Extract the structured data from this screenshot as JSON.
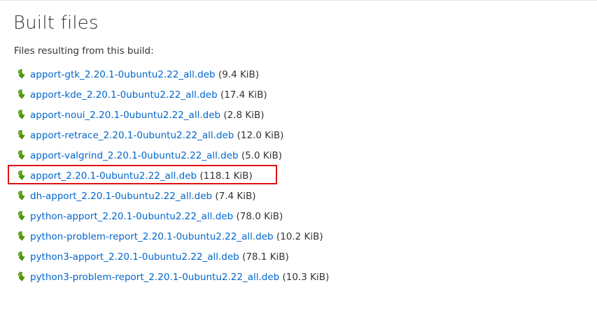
{
  "page": {
    "title": "Built files",
    "intro": "Files resulting from this build:"
  },
  "colors": {
    "link": "#0066cc",
    "icon_green": "#4e9a06",
    "highlight": "#e01111"
  },
  "files": [
    {
      "name": "apport-gtk_2.20.1-0ubuntu2.22_all.deb",
      "size": "(9.4 KiB)",
      "icon": "download-arrow-icon"
    },
    {
      "name": "apport-kde_2.20.1-0ubuntu2.22_all.deb",
      "size": "(17.4 KiB)",
      "icon": "download-arrow-icon"
    },
    {
      "name": "apport-noui_2.20.1-0ubuntu2.22_all.deb",
      "size": "(2.8 KiB)",
      "icon": "download-arrow-icon"
    },
    {
      "name": "apport-retrace_2.20.1-0ubuntu2.22_all.deb",
      "size": "(12.0 KiB)",
      "icon": "download-arrow-icon"
    },
    {
      "name": "apport-valgrind_2.20.1-0ubuntu2.22_all.deb",
      "size": "(5.0 KiB)",
      "icon": "download-arrow-icon"
    },
    {
      "name": "apport_2.20.1-0ubuntu2.22_all.deb",
      "size": "(118.1 KiB)",
      "icon": "download-arrow-icon",
      "highlighted": true
    },
    {
      "name": "dh-apport_2.20.1-0ubuntu2.22_all.deb",
      "size": "(7.4 KiB)",
      "icon": "download-arrow-icon"
    },
    {
      "name": "python-apport_2.20.1-0ubuntu2.22_all.deb",
      "size": "(78.0 KiB)",
      "icon": "download-arrow-icon"
    },
    {
      "name": "python-problem-report_2.20.1-0ubuntu2.22_all.deb",
      "size": "(10.2 KiB)",
      "icon": "download-arrow-icon"
    },
    {
      "name": "python3-apport_2.20.1-0ubuntu2.22_all.deb",
      "size": "(78.1 KiB)",
      "icon": "download-arrow-icon"
    },
    {
      "name": "python3-problem-report_2.20.1-0ubuntu2.22_all.deb",
      "size": "(10.3 KiB)",
      "icon": "download-arrow-icon"
    }
  ]
}
